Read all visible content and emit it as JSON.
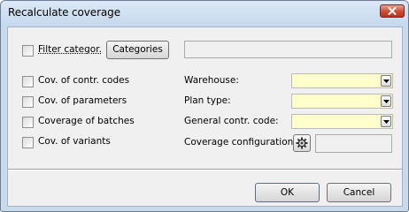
{
  "window": {
    "title": "Recalculate coverage",
    "close_icon": "close-icon"
  },
  "filter": {
    "checkbox_label": "Filter categor.",
    "categories_button": "Categories",
    "categories_value": ""
  },
  "checkboxes": [
    {
      "label": "Cov. of contr. codes",
      "checked": false
    },
    {
      "label": "Cov. of parameters",
      "checked": false
    },
    {
      "label": "Coverage of batches",
      "checked": false
    },
    {
      "label": "Cov. of variants",
      "checked": false
    }
  ],
  "fields": {
    "warehouse": {
      "label": "Warehouse:",
      "value": ""
    },
    "plan_type": {
      "label": "Plan type:",
      "value": ""
    },
    "general_code": {
      "label": "General contr. code:",
      "value": ""
    },
    "coverage_config": {
      "label": "Coverage configuration:",
      "value": "",
      "icon": "gear-icon"
    }
  },
  "buttons": {
    "ok": "OK",
    "cancel": "Cancel"
  },
  "colors": {
    "required_field": "#ffffcc",
    "close_button": "#c8402b"
  }
}
